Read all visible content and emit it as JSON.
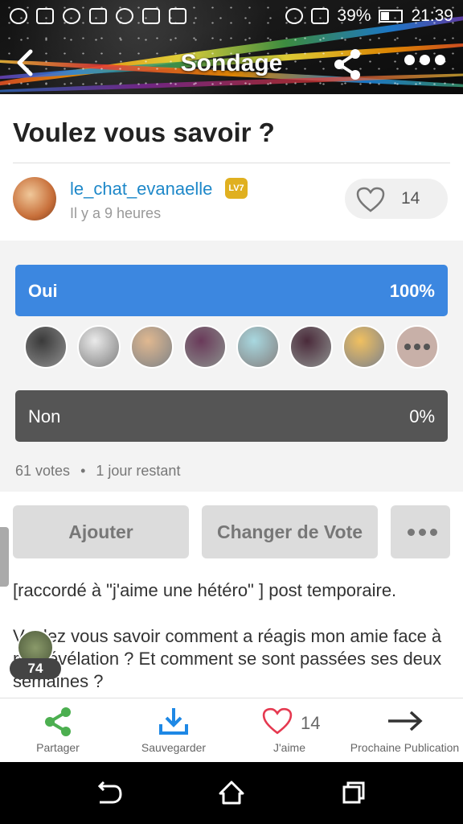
{
  "status_bar": {
    "battery": "39%",
    "time": "21:39"
  },
  "header": {
    "title": "Sondage"
  },
  "post": {
    "title": "Voulez vous savoir ?",
    "author": {
      "name": "le_chat_evanaelle",
      "level_badge": "LV7",
      "time": "Il y a 9 heures"
    },
    "likes": "14"
  },
  "poll": {
    "options": [
      {
        "label": "Oui",
        "percent": "100%"
      },
      {
        "label": "Non",
        "percent": "0%"
      }
    ],
    "votes": "61 votes",
    "separator": "•",
    "remaining": "1 jour restant",
    "voter_colors": [
      "#3a3a3a",
      "#eaeaea",
      "#e0b890",
      "#6a3a5a",
      "#a8d8e0",
      "#4a2a3a",
      "#f0c060",
      "#c8b0a8"
    ]
  },
  "buttons": {
    "add": "Ajouter",
    "change_vote": "Changer de Vote"
  },
  "body": {
    "line1": "[raccordé à \"j'aime une hétéro\" ] post temporaire.",
    "line2": "Voulez vous savoir comment a réagis mon amie face à ma révélation ? Et comment se sont passées ses deux semaines ?"
  },
  "floating": {
    "count": "74"
  },
  "actions": {
    "share": "Partager",
    "save": "Sauvegarder",
    "like": "J'aime",
    "like_count": "14",
    "next": "Prochaine Publication"
  },
  "colors": {
    "accent_blue": "#3c87e0",
    "share_green": "#4caf50",
    "save_blue": "#1e88e5",
    "like_red": "#e53950"
  }
}
